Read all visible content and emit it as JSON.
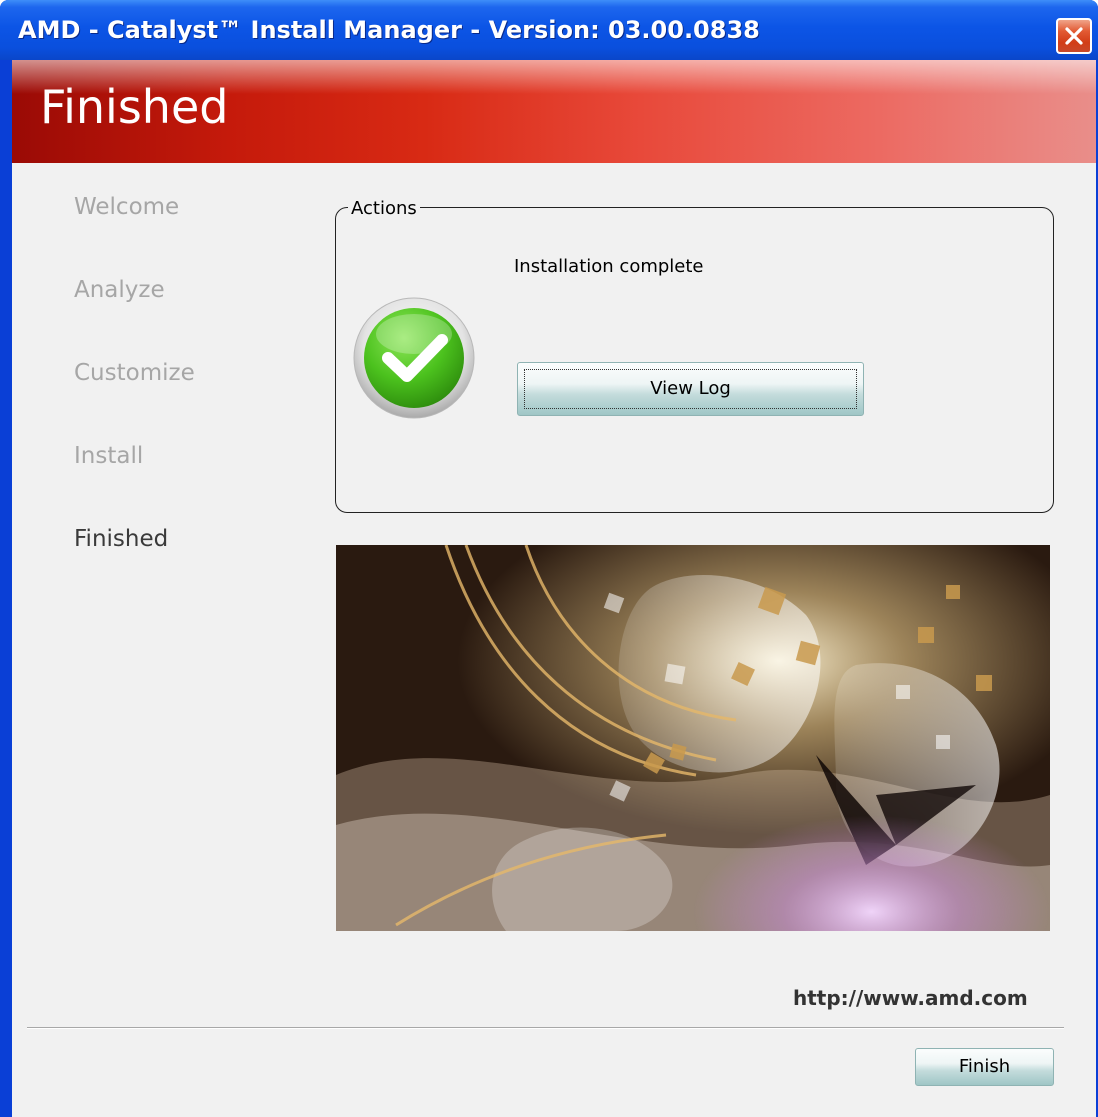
{
  "window": {
    "title": "AMD - Catalyst™ Install Manager - Version: 03.00.0838",
    "close_icon": "close-icon",
    "frame_color": "#0a3fd6"
  },
  "banner": {
    "title": "Finished",
    "gradient_colors": [
      "#9a0a05",
      "#d82a14",
      "#e98e8a"
    ]
  },
  "steps": [
    {
      "label": "Welcome",
      "state": "inactive"
    },
    {
      "label": "Analyze",
      "state": "inactive"
    },
    {
      "label": "Customize",
      "state": "inactive"
    },
    {
      "label": "Install",
      "state": "inactive"
    },
    {
      "label": "Finished",
      "state": "active"
    }
  ],
  "actions": {
    "legend": "Actions",
    "status_text": "Installation complete",
    "status_icon": "check-circle-icon",
    "view_log_label": "View Log"
  },
  "footer": {
    "url": "http://www.amd.com",
    "finish_label": "Finish"
  },
  "colors": {
    "step_inactive": "#a6a6a6",
    "step_active": "#3a3a3a",
    "check_green": "#4cc21e",
    "button_teal": "#9fc6c6"
  }
}
